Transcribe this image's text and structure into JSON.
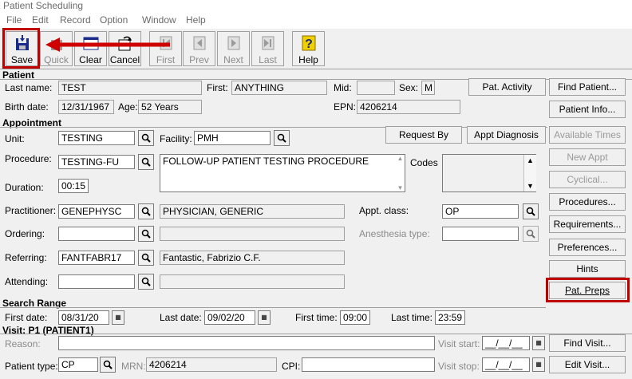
{
  "window": {
    "title": "Patient Scheduling"
  },
  "menu": [
    "File",
    "Edit",
    "Record",
    "Option",
    "Window",
    "Help"
  ],
  "toolbar": {
    "save": "Save",
    "quick": "Quick",
    "clear": "Clear",
    "cancel": "Cancel",
    "first": "First",
    "prev": "Prev",
    "next": "Next",
    "last": "Last",
    "help": "Help"
  },
  "patient": {
    "section": "Patient",
    "last_name_label": "Last name:",
    "last_name": "TEST",
    "first_label": "First:",
    "first": "ANYTHING",
    "mid_label": "Mid:",
    "mid": "",
    "sex_label": "Sex:",
    "sex": "M",
    "birth_label": "Birth date:",
    "birth": "12/31/1967",
    "age_label": "Age:",
    "age": "52 Years",
    "epn_label": "EPN:",
    "epn": "4206214",
    "pat_activity": "Pat. Activity",
    "find_patient": "Find Patient...",
    "patient_info": "Patient Info..."
  },
  "appointment": {
    "section": "Appointment",
    "unit_label": "Unit:",
    "unit": "TESTING",
    "facility_label": "Facility:",
    "facility": "PMH",
    "request_by": "Request By",
    "appt_diagnosis": "Appt Diagnosis",
    "procedure_label": "Procedure:",
    "procedure": "TESTING-FU",
    "procedure_desc": "FOLLOW-UP PATIENT TESTING PROCEDURE",
    "codes_label": "Codes",
    "duration_label": "Duration:",
    "duration": "00:15",
    "practitioner_label": "Practitioner:",
    "practitioner": "GENEPHYSC",
    "practitioner_name": "PHYSICIAN, GENERIC",
    "appt_class_label": "Appt. class:",
    "appt_class": "OP",
    "ordering_label": "Ordering:",
    "ordering": "",
    "anesthesia_label": "Anesthesia type:",
    "anesthesia": "",
    "referring_label": "Referring:",
    "referring": "FANTFABR17",
    "referring_name": "Fantastic, Fabrizio C.F.",
    "attending_label": "Attending:",
    "attending": ""
  },
  "side_buttons": {
    "available_times": "Available Times",
    "new_appt": "New Appt",
    "cyclical": "Cyclical...",
    "procedures": "Procedures...",
    "requirements": "Requirements...",
    "preferences": "Preferences...",
    "hints": "Hints",
    "pat_preps": "Pat. Preps"
  },
  "search": {
    "section": "Search Range",
    "first_date_label": "First date:",
    "first_date": "08/31/20",
    "last_date_label": "Last date:",
    "last_date": "09/02/20",
    "first_time_label": "First time:",
    "first_time": "09:00",
    "last_time_label": "Last time:",
    "last_time": "23:59"
  },
  "visit": {
    "section": "Visit: P1 (PATIENT1)",
    "reason_label": "Reason:",
    "reason": "",
    "visit_start_label": "Visit start:",
    "visit_start": "__/__/__",
    "find_visit": "Find Visit...",
    "patient_type_label": "Patient type:",
    "patient_type": "CP",
    "mrn_label": "MRN:",
    "mrn": "4206214",
    "cpi_label": "CPI:",
    "cpi": "",
    "visit_stop_label": "Visit stop:",
    "visit_stop": "__/__/__",
    "edit_visit": "Edit Visit..."
  },
  "icons": {
    "save": "floppy-disk-icon",
    "lookup": "magnifier-icon",
    "calendar": "calendar-icon",
    "help": "question-mark-icon"
  },
  "colors": {
    "highlight": "#c00000",
    "arrow": "#d00000",
    "help_icon": "#f0d000"
  }
}
